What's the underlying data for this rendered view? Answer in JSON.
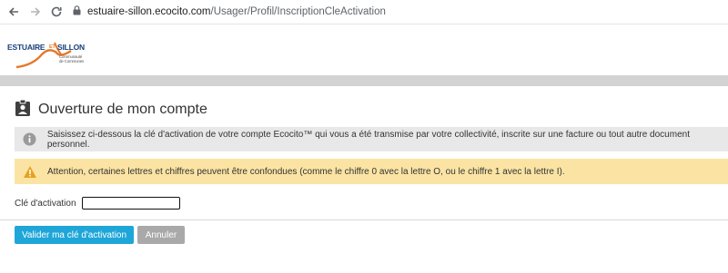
{
  "browser": {
    "url_host": "estuaire-sillon.ecocito.com",
    "url_path": "/Usager/Profil/InscriptionCleActivation"
  },
  "logo": {
    "word1": "ESTUAIRE",
    "word2": "ET",
    "word3": "SILLON",
    "tagline1": "Communauté",
    "tagline2": "de Communes",
    "accent_color": "#e5782a",
    "brand_color": "#1a3f7a"
  },
  "page": {
    "title": "Ouverture de mon compte",
    "title_icon": "id-card-icon"
  },
  "alerts": {
    "info_text": "Saisissez ci-dessous la clé d'activation de votre compte Ecocito™ qui vous a été transmise par votre collectivité, inscrite sur une facture ou tout autre document personnel.",
    "warning_text": "Attention, certaines lettres et chiffres peuvent être confondues (comme le chiffre 0 avec la lettre O, ou le chiffre 1 avec la lettre I)."
  },
  "form": {
    "activation_label": "Clé d'activation",
    "activation_value": ""
  },
  "buttons": {
    "submit_label": "Valider ma clé d'activation",
    "cancel_label": "Annuler"
  },
  "colors": {
    "primary": "#1fa6d8",
    "secondary": "#a9a9a9",
    "warning_bg": "#fbe4a3",
    "info_bg": "#e8e8e8"
  }
}
